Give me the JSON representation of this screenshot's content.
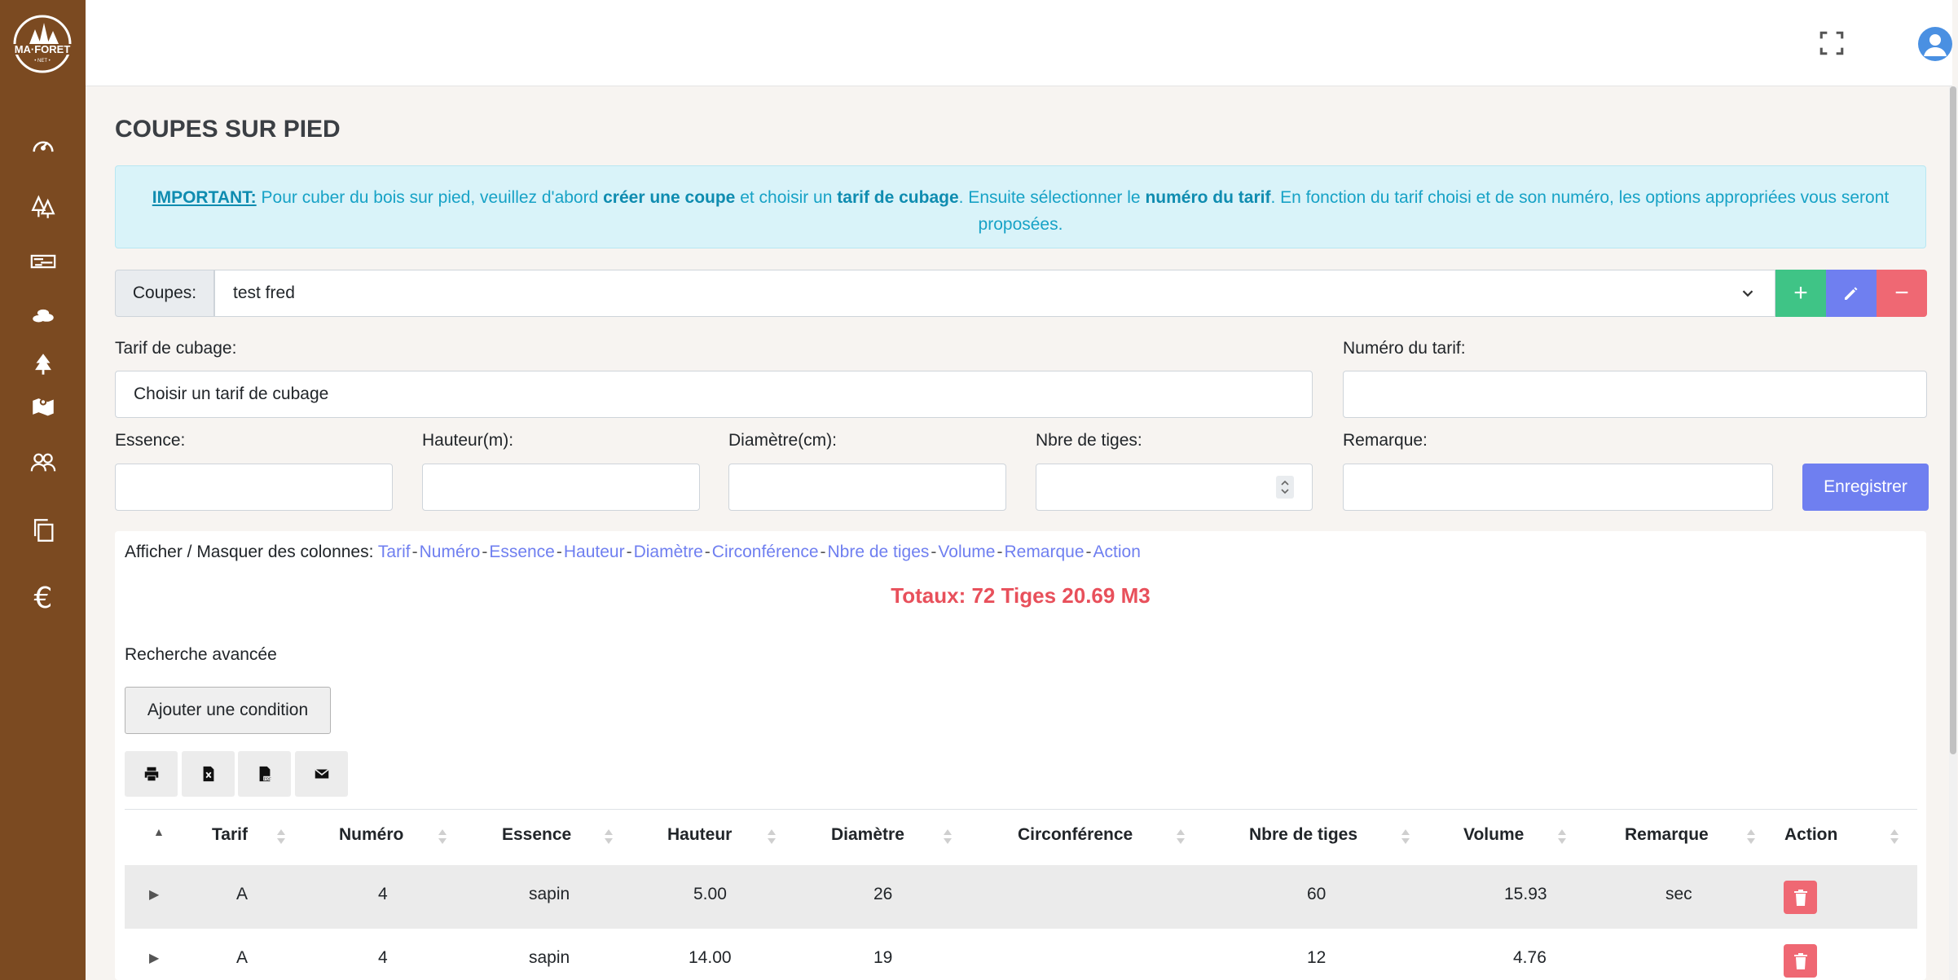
{
  "brand": {
    "logo_text": "MA·FORET",
    "logo_sub": "• NET •",
    "sidebar_color": "#7b4a21"
  },
  "sidebar": {
    "items": [
      {
        "icon": "dashboard-gauge-icon"
      },
      {
        "icon": "forest-trees-icon"
      },
      {
        "icon": "wood-planks-icon"
      },
      {
        "icon": "log-pile-icon"
      },
      {
        "icon": "tree-icon"
      },
      {
        "icon": "map-icon"
      },
      {
        "icon": "users-icon"
      },
      {
        "icon": "copy-documents-icon"
      },
      {
        "icon": "euro-icon",
        "glyph": "€"
      }
    ]
  },
  "page": {
    "title": "COUPES SUR PIED"
  },
  "alert": {
    "important": "IMPORTANT:",
    "t1": " Pour cuber du bois sur pied, veuillez d'abord ",
    "b1": "créer une coupe",
    "t2": " et choisir un ",
    "b2": "tarif de cubage",
    "t3": ". Ensuite sélectionner le ",
    "b3": "numéro du tarif",
    "t4": ". En fonction du tarif choisi et de son numéro, les options appropriées vous seront proposées."
  },
  "coupes": {
    "label": "Coupes:",
    "selected": "test fred",
    "add": "+",
    "remove": "−"
  },
  "form": {
    "tarif_label": "Tarif de cubage:",
    "tarif_value": "Choisir un tarif de cubage",
    "numero_label": "Numéro du tarif:",
    "numero_value": "",
    "essence_label": "Essence:",
    "hauteur_label": "Hauteur(m):",
    "diametre_label": "Diamètre(cm):",
    "tiges_label": "Nbre de tiges:",
    "remarque_label": "Remarque:",
    "save": "Enregistrer"
  },
  "columns_toggle": {
    "prefix": "Afficher / Masquer des colonnes:",
    "items": [
      "Tarif",
      "Numéro",
      "Essence",
      "Hauteur",
      "Diamètre",
      "Circonférence",
      "Nbre de tiges",
      "Volume",
      "Remarque",
      "Action"
    ],
    "sep": "-"
  },
  "totals": "Totaux: 72 Tiges 20.69 M3",
  "advanced": {
    "label": "Recherche avancée",
    "add_condition": "Ajouter une condition"
  },
  "export": [
    "print-icon",
    "excel-icon",
    "pdf-icon",
    "email-icon"
  ],
  "table": {
    "headers": [
      "Tarif",
      "Numéro",
      "Essence",
      "Hauteur",
      "Diamètre",
      "Circonférence",
      "Nbre de tiges",
      "Volume",
      "Remarque",
      "Action"
    ],
    "rows": [
      {
        "tarif": "A",
        "numero": "4",
        "essence": "sapin",
        "hauteur": "5.00",
        "diametre": "26",
        "circonference": "",
        "tiges": "60",
        "volume": "15.93",
        "remarque": "sec"
      },
      {
        "tarif": "A",
        "numero": "4",
        "essence": "sapin",
        "hauteur": "14.00",
        "diametre": "19",
        "circonference": "",
        "tiges": "12",
        "volume": "4.76",
        "remarque": ""
      }
    ],
    "expand_glyph": "▶",
    "sort_up_glyph": "▲"
  }
}
